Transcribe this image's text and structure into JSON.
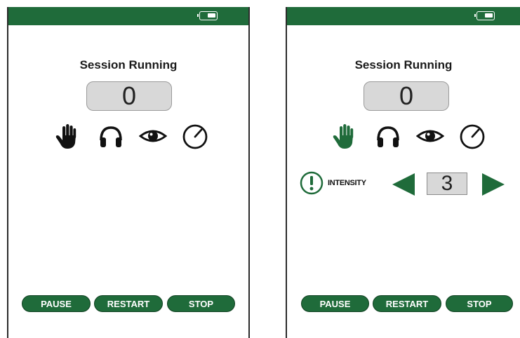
{
  "colors": {
    "accent": "#1f6b3a",
    "icon_black": "#111111",
    "icon_green": "#1f6b3a"
  },
  "screens": [
    {
      "title": "Session Running",
      "counter": "0",
      "icons": [
        "hand-icon",
        "headphones-icon",
        "eye-icon",
        "dial-icon"
      ],
      "selected_icon": null,
      "buttons": {
        "pause": "PAUSE",
        "restart": "RESTART",
        "stop": "STOP"
      }
    },
    {
      "title": "Session Running",
      "counter": "0",
      "icons": [
        "hand-icon",
        "headphones-icon",
        "eye-icon",
        "dial-icon"
      ],
      "selected_icon": "hand-icon",
      "intensity": {
        "label": "INTENSITY",
        "value": "3"
      },
      "buttons": {
        "pause": "PAUSE",
        "restart": "RESTART",
        "stop": "STOP"
      }
    }
  ]
}
